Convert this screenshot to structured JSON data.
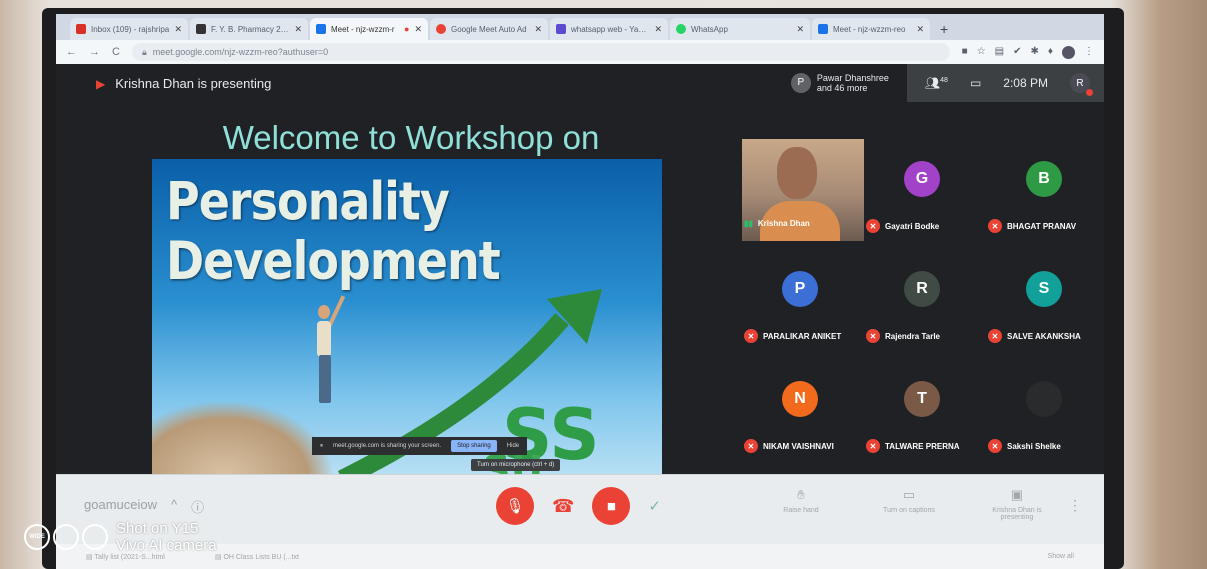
{
  "browser": {
    "tabs": [
      {
        "label": "Inbox (109) - rajshripa",
        "color": "#d93025",
        "active": false
      },
      {
        "label": "F. Y. B. Pharmacy 2021-",
        "color": "#333333",
        "active": false
      },
      {
        "label": "Meet - njz-wzzm-r",
        "color": "#1a73e8",
        "active": true
      },
      {
        "label": "Google Meet Auto Ad",
        "color": "#ea4335",
        "active": false
      },
      {
        "label": "whatsapp web - Yahoo",
        "color": "#5c4bcf",
        "active": false
      },
      {
        "label": "WhatsApp",
        "color": "#25d366",
        "active": false
      },
      {
        "label": "Meet - njz-wzzm-reo",
        "color": "#1a73e8",
        "active": false
      }
    ],
    "url": "meet.google.com/njz-wzzm-reo?authuser=0"
  },
  "meet": {
    "presenting_text": "Krishna Dhan is presenting",
    "participants_summary": {
      "initial": "P",
      "line1": "Pawar Dhanshree",
      "line2": "and 46 more"
    },
    "participant_count": "48",
    "time": "2:08 PM",
    "user_initial": "R",
    "slide": {
      "title": "Welcome to Workshop on",
      "line1": "Personality",
      "line2": "Development",
      "sharing_notice": "meet.google.com is sharing your screen.",
      "stop_sharing": "Stop sharing",
      "hide": "Hide"
    },
    "tiles": [
      {
        "name": "Krishna Dhan",
        "initial": "",
        "color": "",
        "video": true
      },
      {
        "name": "Gayatri Bodke",
        "initial": "G",
        "color": "#a142c8",
        "video": false
      },
      {
        "name": "BHAGAT PRANAV",
        "initial": "B",
        "color": "#2e9a45",
        "video": false
      },
      {
        "name": "PARALIKAR ANIKET",
        "initial": "P",
        "color": "#3b6fd6",
        "video": false
      },
      {
        "name": "Rajendra Tarle",
        "initial": "R",
        "color": "#3f4b44",
        "video": false
      },
      {
        "name": "SALVE AKANKSHA",
        "initial": "S",
        "color": "#12a19a",
        "video": false
      },
      {
        "name": "NIKAM VAISHNAVI",
        "initial": "N",
        "color": "#f26b1d",
        "video": false
      },
      {
        "name": "TALWARE PRERNA",
        "initial": "T",
        "color": "#7a5a46",
        "video": false
      },
      {
        "name": "Sakshi Shelke",
        "initial": "",
        "color": "#2a2b2d",
        "video": false
      }
    ]
  },
  "controls": {
    "meeting_code": "goamuceiow",
    "mic_tooltip": "Turn on microphone (ctrl + d)",
    "raise_hand": "Raise hand",
    "captions": "Turn on captions",
    "presenting": "Krishna Dhan is presenting"
  },
  "downloads": {
    "item1": "Tally list (2021-S...html",
    "item2": "OH Class Lists BU (...txt",
    "show_all": "Show all"
  },
  "watermark": {
    "wide": "WIDE",
    "line1": "Shot on Y15",
    "line2": "Vivo AI camera"
  }
}
